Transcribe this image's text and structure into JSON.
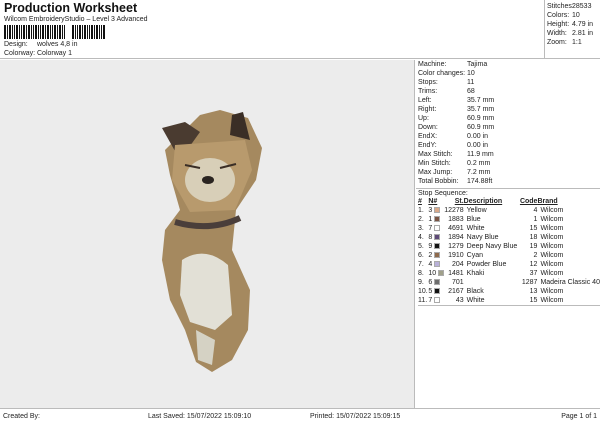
{
  "header": {
    "title": "Production Worksheet",
    "subtitle": "Wilcom EmbroideryStudio – Level 3 Advanced",
    "design_label": "Design:",
    "design_value": "wolves 4,8 in",
    "colorway_label": "Colorway:",
    "colorway_value": "Colorway 1"
  },
  "stats": [
    {
      "k": "Stitches:",
      "v": "28533"
    },
    {
      "k": "Colors:",
      "v": "10"
    },
    {
      "k": "Height:",
      "v": "4.79 in"
    },
    {
      "k": "Width:",
      "v": "2.81 in"
    },
    {
      "k": "Zoom:",
      "v": "1:1"
    }
  ],
  "properties": [
    {
      "k": "Machine:",
      "v": "Tajima"
    },
    {
      "k": "Color changes:",
      "v": "10"
    },
    {
      "k": "Stops:",
      "v": "11"
    },
    {
      "k": "Trims:",
      "v": "68"
    },
    {
      "k": "Left:",
      "v": "35.7 mm"
    },
    {
      "k": "Right:",
      "v": "35.7 mm"
    },
    {
      "k": "Up:",
      "v": "60.9 mm"
    },
    {
      "k": "Down:",
      "v": "60.9 mm"
    },
    {
      "k": "EndX:",
      "v": "0.00 in"
    },
    {
      "k": "EndY:",
      "v": "0.00 in"
    },
    {
      "k": "Max Stitch:",
      "v": "11.9 mm"
    },
    {
      "k": "Min Stitch:",
      "v": "0.2 mm"
    },
    {
      "k": "Max Jump:",
      "v": "7.2 mm"
    },
    {
      "k": "Total Bobbin:",
      "v": "174.88ft"
    }
  ],
  "stop_sequence": {
    "label": "Stop Sequence:",
    "headers": [
      "#",
      "N#",
      "St.",
      "Description",
      "Code",
      "Brand"
    ],
    "rows": [
      {
        "i": "1.",
        "n": "3",
        "color": "#d9a98a",
        "st": "12278",
        "desc": "Yellow",
        "code": "4",
        "brand": "Wilcom"
      },
      {
        "i": "2.",
        "n": "1",
        "color": "#7a5545",
        "st": "1883",
        "desc": "Blue",
        "code": "1",
        "brand": "Wilcom"
      },
      {
        "i": "3.",
        "n": "7",
        "color": "#ffffff",
        "st": "4691",
        "desc": "White",
        "code": "15",
        "brand": "Wilcom"
      },
      {
        "i": "4.",
        "n": "8",
        "color": "#5e4a78",
        "st": "1894",
        "desc": "Navy Blue",
        "code": "18",
        "brand": "Wilcom"
      },
      {
        "i": "5.",
        "n": "9",
        "color": "#141414",
        "st": "1279",
        "desc": "Deep Navy Blue",
        "code": "19",
        "brand": "Wilcom"
      },
      {
        "i": "6.",
        "n": "2",
        "color": "#8e6a4c",
        "st": "1910",
        "desc": "Cyan",
        "code": "2",
        "brand": "Wilcom"
      },
      {
        "i": "7.",
        "n": "4",
        "color": "#b8b0d8",
        "st": "204",
        "desc": "Powder Blue",
        "code": "12",
        "brand": "Wilcom"
      },
      {
        "i": "8.",
        "n": "10",
        "color": "#a0a08a",
        "st": "1481",
        "desc": "Khaki",
        "code": "37",
        "brand": "Wilcom"
      },
      {
        "i": "9.",
        "n": "6",
        "color": "#6e6e6e",
        "st": "701",
        "desc": "",
        "code": "1287",
        "brand": "Madeira Classic 40"
      },
      {
        "i": "10.",
        "n": "5",
        "color": "#111111",
        "st": "2167",
        "desc": "Black",
        "code": "13",
        "brand": "Wilcom"
      },
      {
        "i": "11.",
        "n": "7",
        "color": "#ffffff",
        "st": "43",
        "desc": "White",
        "code": "15",
        "brand": "Wilcom"
      }
    ]
  },
  "footer": {
    "created": "Created By:",
    "saved": "Last Saved: 15/07/2022 15:09:10",
    "printed": "Printed: 15/07/2022 15:09:15",
    "page": "Page 1 of 1"
  }
}
